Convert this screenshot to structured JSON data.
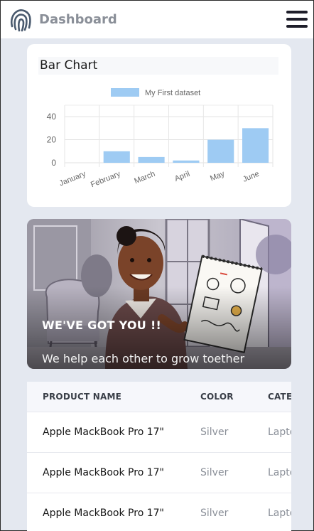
{
  "header": {
    "brand": "Dashboard"
  },
  "chart_card": {
    "title": "Bar Chart"
  },
  "chart_data": {
    "type": "bar",
    "title": "",
    "categories": [
      "January",
      "February",
      "March",
      "April",
      "May",
      "June"
    ],
    "series": [
      {
        "name": "My First dataset",
        "values": [
          0,
          10,
          5,
          2,
          20,
          30
        ],
        "color": "#9ecbf3"
      }
    ],
    "ylim": [
      0,
      45
    ],
    "yticks": [
      0,
      20,
      40
    ],
    "grid": true,
    "legend": "top"
  },
  "hero": {
    "title": "WE'VE GOT YOU !!",
    "subtitle": "We help each other to grow toether"
  },
  "table": {
    "columns": [
      "PRODUCT NAME",
      "COLOR",
      "CATEGORY"
    ],
    "rows": [
      [
        "Apple MackBook Pro 17\"",
        "Silver",
        "Laptop"
      ],
      [
        "Apple MackBook Pro 17\"",
        "Silver",
        "Laptop"
      ],
      [
        "Apple MackBook Pro 17\"",
        "Silver",
        "Laptop"
      ]
    ]
  }
}
